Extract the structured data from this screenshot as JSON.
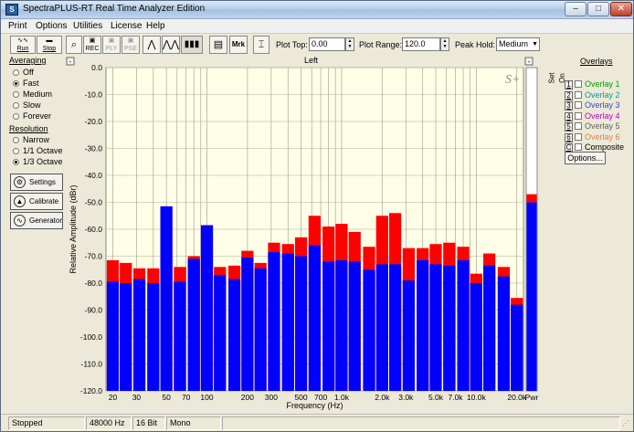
{
  "window": {
    "title": "SpectraPLUS-RT Real Time Analyzer Edition",
    "minimize": "–",
    "maximize": "□",
    "close": "✕"
  },
  "menu": [
    "Print",
    "Options",
    "Utilities",
    "License",
    "Help"
  ],
  "toolbar": {
    "run": "Run",
    "stop": "Stop",
    "plot_top_label": "Plot Top:",
    "plot_top_value": "0.00",
    "plot_range_label": "Plot Range:",
    "plot_range_value": "120.0",
    "peak_hold_label": "Peak Hold:",
    "peak_hold_value": "Medium",
    "mrk": "Mrk"
  },
  "averaging": {
    "title": "Averaging",
    "options": [
      "Off",
      "Fast",
      "Medium",
      "Slow",
      "Forever"
    ],
    "selected": "Fast"
  },
  "resolution": {
    "title": "Resolution",
    "options": [
      "Narrow",
      "1/1 Octave",
      "1/3 Octave"
    ],
    "selected": "1/3 Octave"
  },
  "buttons": {
    "settings": "Settings",
    "calibrate": "Calibrate",
    "generator": "Generator"
  },
  "overlays": {
    "title": "Overlays",
    "set": "Set",
    "on": "On",
    "items": [
      {
        "num": "1",
        "label": "Overlay 1",
        "color": "#00a000"
      },
      {
        "num": "2",
        "label": "Overlay 2",
        "color": "#00a0a0"
      },
      {
        "num": "3",
        "label": "Overlay 3",
        "color": "#3050c0"
      },
      {
        "num": "4",
        "label": "Overlay 4",
        "color": "#c000c0"
      },
      {
        "num": "5",
        "label": "Overlay 5",
        "color": "#606060"
      },
      {
        "num": "6",
        "label": "Overlay 6",
        "color": "#e08040"
      },
      {
        "num": "C",
        "label": "Composite",
        "color": "#000000"
      }
    ],
    "options_button": "Options..."
  },
  "status": {
    "state": "Stopped",
    "rate": "48000 Hz",
    "bits": "16 Bit",
    "channel": "Mono"
  },
  "colors": {
    "peak": "#ff0000",
    "level": "#0000ff",
    "plot_bg": "#ffffe8"
  },
  "chart_data": {
    "type": "bar",
    "title": "Left",
    "xlabel": "Frequency (Hz)",
    "ylabel": "Relative Amplitude (dBr)",
    "ylim": [
      -120,
      0
    ],
    "yticks": [
      "0.0",
      "-10.0",
      "-20.0",
      "-30.0",
      "-40.0",
      "-50.0",
      "-60.0",
      "-70.0",
      "-80.0",
      "-90.0",
      "-100.0",
      "-110.0",
      "-120.0"
    ],
    "xtick_labels": [
      "20",
      "30",
      "50",
      "70",
      "100",
      "200",
      "300",
      "500",
      "700",
      "1.0k",
      "2.0k",
      "3.0k",
      "5.0k",
      "7.0k",
      "10.0k",
      "20.0k"
    ],
    "categories": [
      "20",
      "25",
      "31.5",
      "40",
      "50",
      "63",
      "80",
      "100",
      "125",
      "160",
      "200",
      "250",
      "315",
      "400",
      "500",
      "630",
      "800",
      "1k",
      "1.25k",
      "1.6k",
      "2k",
      "2.5k",
      "3.15k",
      "4k",
      "5k",
      "6.3k",
      "8k",
      "10k",
      "12.5k",
      "16k",
      "20k"
    ],
    "series": [
      {
        "name": "Peak",
        "values": [
          -71.5,
          -72.5,
          -74.5,
          -74.5,
          -51.5,
          -74.0,
          -70.0,
          -58.5,
          -74.0,
          -73.5,
          -68.0,
          -72.5,
          -65.0,
          -65.5,
          -63.0,
          -55.0,
          -59.0,
          -58.0,
          -61.0,
          -66.5,
          -55.0,
          -54.0,
          -67.0,
          -67.0,
          -65.5,
          -65.0,
          -66.5,
          -76.5,
          -69.0,
          -74.0,
          -85.5
        ]
      },
      {
        "name": "Level",
        "values": [
          -79.5,
          -80.0,
          -78.5,
          -80.0,
          -51.5,
          -79.5,
          -71.0,
          -58.5,
          -77.0,
          -78.5,
          -70.5,
          -74.5,
          -68.5,
          -69.0,
          -70.0,
          -66.0,
          -72.0,
          -71.5,
          -72.0,
          -75.0,
          -73.0,
          -73.0,
          -79.0,
          -71.5,
          -73.0,
          -73.5,
          -71.5,
          -80.0,
          -73.5,
          -77.5,
          -88.0
        ]
      }
    ],
    "pwr": {
      "label": "Pwr",
      "peak": -47.0,
      "level": -50.0
    }
  }
}
